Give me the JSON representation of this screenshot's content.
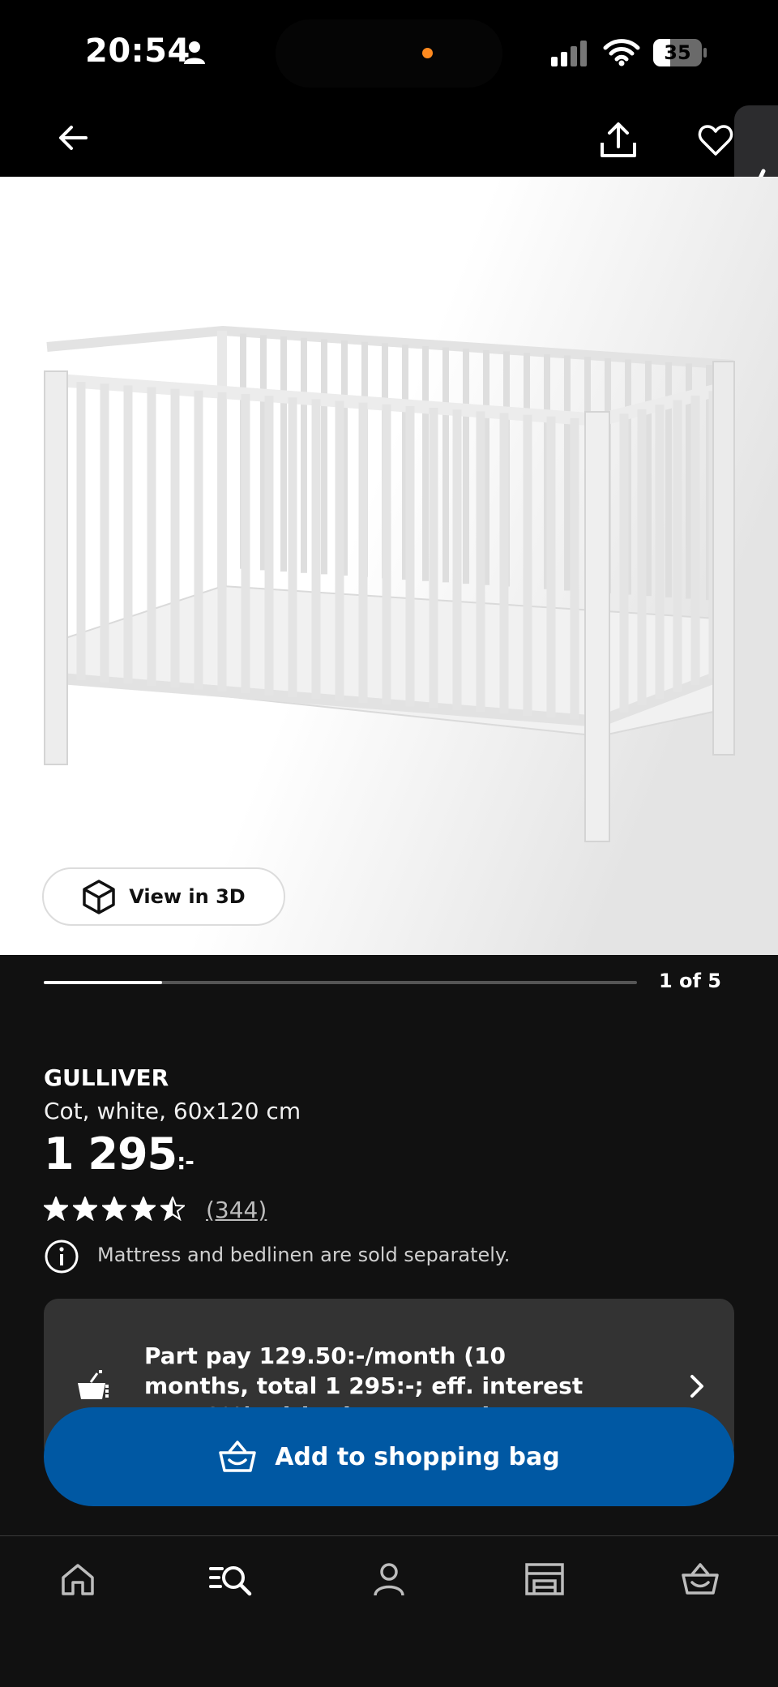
{
  "status_bar": {
    "time": "20:54",
    "battery": "35",
    "battery_level": 0.35,
    "icons": [
      "person-icon",
      "cellular-signal-icon",
      "wifi-icon",
      "battery-icon"
    ]
  },
  "nav": {
    "icons": [
      "arrow-left-icon",
      "share-icon",
      "heart-icon",
      "chevron-left-icon"
    ]
  },
  "gallery": {
    "view_3d_label": "View in 3D",
    "pager_label": "1 of 5",
    "current": 1,
    "total": 5
  },
  "product": {
    "name": "GULLIVER",
    "description": "Cot, white, 60x120 cm",
    "price": "1 295",
    "price_suffix": ":-",
    "rating": 4.5,
    "rating_count": "(344)",
    "notice": "Mattress and bedlinen are sold separately."
  },
  "part_pay": {
    "text": "Part pay 129.50:-/month (10 months, total 1 295:-; eff. interest rate 0%) with Klarna. Read more"
  },
  "cta": {
    "label": "Add to shopping bag"
  },
  "tabbar": {
    "items": [
      "home-icon",
      "search-icon",
      "profile-icon",
      "store-icon",
      "bag-icon"
    ]
  },
  "colors": {
    "background": "#111111",
    "accent": "#0058a3",
    "card": "#333333",
    "island_dot": "#ff8a1f"
  }
}
